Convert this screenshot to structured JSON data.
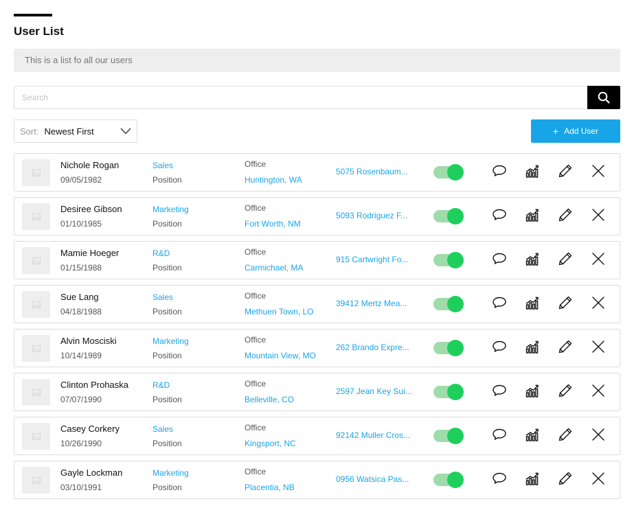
{
  "header": {
    "title": "User List",
    "description": "This is a list fo all our users"
  },
  "search": {
    "placeholder": "Search",
    "value": ""
  },
  "sort": {
    "label": "Sort:",
    "value": "Newest First"
  },
  "add_user": {
    "label": "Add User"
  },
  "colors": {
    "accent": "#17a5e8",
    "toggle_on": "#1fcf5c"
  },
  "icons": {
    "search": "search-icon",
    "message": "chat-bubble-icon",
    "stats": "chart-icon",
    "edit": "pencil-icon",
    "delete": "close-icon"
  },
  "users": [
    {
      "name": "Nichole Rogan",
      "dob": "09/05/1982",
      "department": "Sales",
      "position": "Position",
      "office_label": "Office",
      "location": "Huntington, WA",
      "address": "5075 Rosenbaum...",
      "active": true
    },
    {
      "name": "Desiree Gibson",
      "dob": "01/10/1985",
      "department": "Marketing",
      "position": "Position",
      "office_label": "Office",
      "location": "Fort Worth, NM",
      "address": "5093 Rodriguez F...",
      "active": true
    },
    {
      "name": "Mamie Hoeger",
      "dob": "01/15/1988",
      "department": "R&D",
      "position": "Position",
      "office_label": "Office",
      "location": "Carmichael, MA",
      "address": "915 Cartwright Fo...",
      "active": true
    },
    {
      "name": "Sue Lang",
      "dob": "04/18/1988",
      "department": "Sales",
      "position": "Position",
      "office_label": "Office",
      "location": "Methuen Town, LO",
      "address": "39412 Mertz Mea...",
      "active": true
    },
    {
      "name": "Alvin Mosciski",
      "dob": "10/14/1989",
      "department": "Marketing",
      "position": "Position",
      "office_label": "Office",
      "location": "Mountain View, MO",
      "address": "262 Brando Expre...",
      "active": true
    },
    {
      "name": "Clinton Prohaska",
      "dob": "07/07/1990",
      "department": "R&D",
      "position": "Position",
      "office_label": "Office",
      "location": "Belleville, CO",
      "address": "2597 Jean Key Sui...",
      "active": true
    },
    {
      "name": "Casey Corkery",
      "dob": "10/26/1990",
      "department": "Sales",
      "position": "Position",
      "office_label": "Office",
      "location": "Kingsport, NC",
      "address": "92142 Muller Cros...",
      "active": true
    },
    {
      "name": "Gayle Lockman",
      "dob": "03/10/1991",
      "department": "Marketing",
      "position": "Position",
      "office_label": "Office",
      "location": "Placentia, NB",
      "address": "0956 Watsica Pas...",
      "active": true
    }
  ]
}
